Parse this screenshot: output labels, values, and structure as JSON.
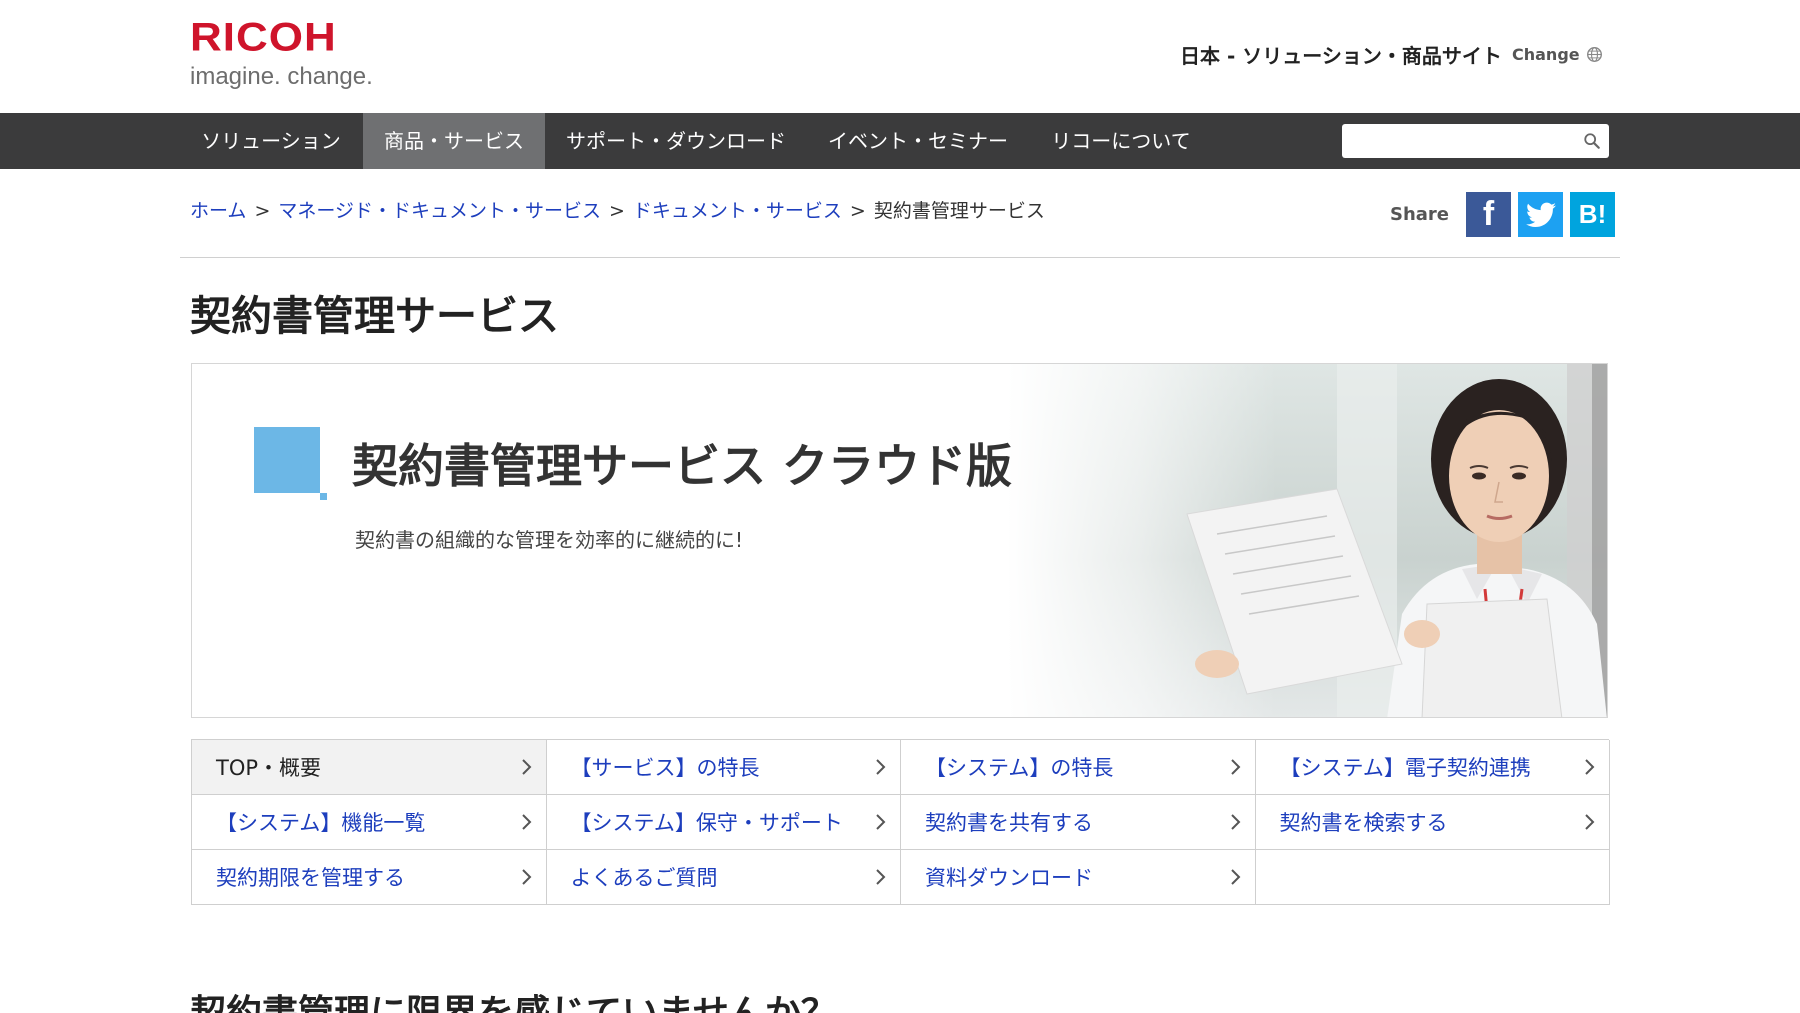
{
  "brand": {
    "logo_text": "RICOH",
    "tagline": "imagine. change.",
    "logo_color": "#cf142b"
  },
  "header": {
    "site_name": "日本 - ソリューション・商品サイト",
    "change_label": "Change",
    "change_icon": "globe-icon"
  },
  "nav": {
    "items": [
      {
        "label": "ソリューション",
        "active": false
      },
      {
        "label": "商品・サービス",
        "active": true
      },
      {
        "label": "サポート・ダウンロード",
        "active": false
      },
      {
        "label": "イベント・セミナー",
        "active": false
      },
      {
        "label": "リコーについて",
        "active": false
      }
    ],
    "search_placeholder": "",
    "search_icon": "search-icon",
    "bar_color": "#3b3b3c",
    "active_color": "#6f7072"
  },
  "breadcrumb": {
    "items": [
      "ホーム",
      "マネージド・ドキュメント・サービス",
      "ドキュメント・サービス"
    ],
    "separator": ">",
    "current": "契約書管理サービス"
  },
  "share": {
    "label": "Share",
    "buttons": [
      {
        "name": "facebook",
        "text": "f",
        "color": "#3b5998"
      },
      {
        "name": "twitter",
        "icon": "twitter-bird-icon",
        "color": "#1da1f2"
      },
      {
        "name": "hatena",
        "text": "B!",
        "color": "#00a4de"
      }
    ]
  },
  "page": {
    "title": "契約書管理サービス"
  },
  "hero": {
    "title": "契約書管理サービス クラウド版",
    "subtitle": "契約書の組織的な管理を効率的に継続的に!",
    "accent_color": "#6cb7e6"
  },
  "subnav": {
    "items": [
      {
        "label": "TOP・概要",
        "active": true
      },
      {
        "label": "【サービス】の特長",
        "active": false
      },
      {
        "label": "【システム】の特長",
        "active": false
      },
      {
        "label": "【システム】電子契約連携",
        "active": false
      },
      {
        "label": "【システム】機能一覧",
        "active": false
      },
      {
        "label": "【システム】保守・サポート",
        "active": false
      },
      {
        "label": "契約書を共有する",
        "active": false
      },
      {
        "label": "契約書を検索する",
        "active": false
      },
      {
        "label": "契約期限を管理する",
        "active": false
      },
      {
        "label": "よくあるご質問",
        "active": false
      },
      {
        "label": "資料ダウンロード",
        "active": false
      }
    ],
    "link_color": "#1d3ebd"
  },
  "section": {
    "heading": "契約書管理に限界を感じていませんか？"
  }
}
